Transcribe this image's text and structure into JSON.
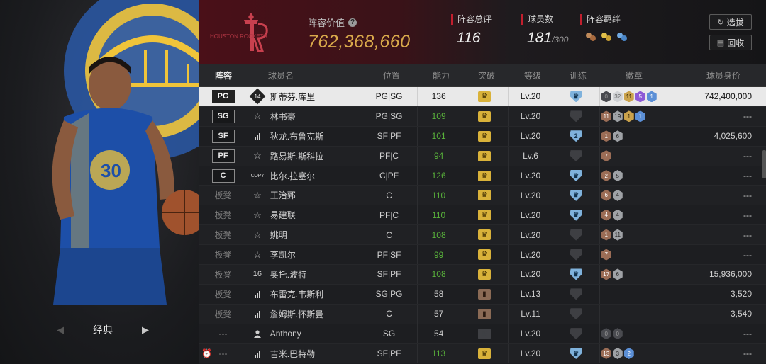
{
  "left_panel": {
    "classic_label": "经典"
  },
  "header": {
    "team_logo_text": "HOUSTON ROCKETS",
    "lineup_value_label": "阵容价值",
    "lineup_value": "762,368,660",
    "overall_label": "阵容总评",
    "overall_value": "116",
    "players_label": "球员数",
    "players_count": "181",
    "players_max": "/300",
    "bond_label": "阵容羁绊",
    "select_button": "选拔",
    "recycle_button": "回收"
  },
  "columns": {
    "lineup": "阵容",
    "name": "球员名",
    "position": "位置",
    "ability": "能力",
    "breakthrough": "突破",
    "level": "等级",
    "training": "训练",
    "badges": "徽章",
    "worth": "球员身价"
  },
  "rows": [
    {
      "slot": "PG",
      "slot_type": "chip",
      "tier": "14",
      "tier_type": "diamond",
      "name": "斯蒂芬.库里",
      "position": "PG|SG",
      "ability": "136",
      "ability_color": "normal",
      "breakthrough": "gold",
      "level": "Lv.20",
      "training": "blue",
      "training_num": "",
      "badges": [
        [
          "empty",
          "0"
        ],
        [
          "lightgray",
          "32"
        ],
        [
          "gold",
          "11"
        ],
        [
          "purple",
          "5"
        ],
        [
          "blue",
          "1"
        ]
      ],
      "worth": "742,400,000",
      "selected": true
    },
    {
      "slot": "SG",
      "slot_type": "chip",
      "tier": "",
      "tier_type": "star",
      "name": "林书豪",
      "position": "PG|SG",
      "ability": "109",
      "ability_color": "green",
      "breakthrough": "gold",
      "level": "Lv.20",
      "training": "gray",
      "training_num": "",
      "badges": [
        [
          "bronze",
          "11"
        ],
        [
          "silver",
          "19"
        ],
        [
          "gold",
          "1"
        ],
        [
          "blue",
          "1"
        ]
      ],
      "worth": "---"
    },
    {
      "slot": "SF",
      "slot_type": "chip",
      "tier": "",
      "tier_type": "bars",
      "name": "狄龙.布鲁克斯",
      "position": "SF|PF",
      "ability": "101",
      "ability_color": "green",
      "breakthrough": "gold",
      "level": "Lv.20",
      "training": "blue",
      "training_num": "2",
      "badges": [
        [
          "bronze",
          "1"
        ],
        [
          "silver",
          "6"
        ]
      ],
      "worth": "4,025,600"
    },
    {
      "slot": "PF",
      "slot_type": "chip",
      "tier": "",
      "tier_type": "star",
      "name": "路易斯.斯科拉",
      "position": "PF|C",
      "ability": "94",
      "ability_color": "green",
      "breakthrough": "gold",
      "level": "Lv.6",
      "training": "gray",
      "training_num": "",
      "badges": [
        [
          "bronze",
          "7"
        ]
      ],
      "worth": "---"
    },
    {
      "slot": "C",
      "slot_type": "chip",
      "tier": "COPY",
      "tier_type": "copy",
      "name": "比尔.拉塞尔",
      "position": "C|PF",
      "ability": "126",
      "ability_color": "green",
      "breakthrough": "gold",
      "level": "Lv.20",
      "training": "blue",
      "training_num": "",
      "badges": [
        [
          "bronze",
          "2"
        ],
        [
          "silver",
          "5"
        ]
      ],
      "worth": "---"
    },
    {
      "slot": "板凳",
      "slot_type": "bench",
      "tier": "",
      "tier_type": "star",
      "name": "王治郅",
      "position": "C",
      "ability": "110",
      "ability_color": "green",
      "breakthrough": "gold",
      "level": "Lv.20",
      "training": "blue",
      "training_num": "",
      "badges": [
        [
          "bronze",
          "6"
        ],
        [
          "silver",
          "4"
        ]
      ],
      "worth": "---"
    },
    {
      "slot": "板凳",
      "slot_type": "bench",
      "tier": "",
      "tier_type": "star",
      "name": "易建联",
      "position": "PF|C",
      "ability": "110",
      "ability_color": "green",
      "breakthrough": "gold",
      "level": "Lv.20",
      "training": "blue",
      "training_num": "",
      "badges": [
        [
          "bronze",
          "4"
        ],
        [
          "silver",
          "4"
        ]
      ],
      "worth": "---"
    },
    {
      "slot": "板凳",
      "slot_type": "bench",
      "tier": "",
      "tier_type": "star",
      "name": "姚明",
      "position": "C",
      "ability": "108",
      "ability_color": "green",
      "breakthrough": "gold",
      "level": "Lv.20",
      "training": "gray",
      "training_num": "",
      "badges": [
        [
          "bronze",
          "1"
        ],
        [
          "silver",
          "11"
        ]
      ],
      "worth": "---"
    },
    {
      "slot": "板凳",
      "slot_type": "bench",
      "tier": "",
      "tier_type": "star",
      "name": "李凯尔",
      "position": "PF|SF",
      "ability": "99",
      "ability_color": "green",
      "breakthrough": "gold",
      "level": "Lv.20",
      "training": "gray",
      "training_num": "",
      "badges": [
        [
          "bronze",
          "7"
        ]
      ],
      "worth": "---"
    },
    {
      "slot": "板凳",
      "slot_type": "bench",
      "tier": "16",
      "tier_type": "num",
      "name": "奥托.波特",
      "position": "SF|PF",
      "ability": "108",
      "ability_color": "green",
      "breakthrough": "gold",
      "level": "Lv.20",
      "training": "blue",
      "training_num": "",
      "badges": [
        [
          "bronze",
          "17"
        ],
        [
          "silver",
          "6"
        ]
      ],
      "worth": "15,936,000"
    },
    {
      "slot": "板凳",
      "slot_type": "bench",
      "tier": "",
      "tier_type": "bars",
      "name": "布雷克.韦斯利",
      "position": "SG|PG",
      "ability": "58",
      "ability_color": "normal",
      "breakthrough": "brown",
      "level": "Lv.13",
      "training": "gray",
      "training_num": "",
      "badges": [],
      "worth": "3,520"
    },
    {
      "slot": "板凳",
      "slot_type": "bench",
      "tier": "",
      "tier_type": "bars",
      "name": "詹姆斯.怀斯曼",
      "position": "C",
      "ability": "57",
      "ability_color": "normal",
      "breakthrough": "brown",
      "level": "Lv.11",
      "training": "gray",
      "training_num": "",
      "badges": [],
      "worth": "3,540"
    },
    {
      "slot": "---",
      "slot_type": "bench",
      "tier": "",
      "tier_type": "person",
      "name": "Anthony",
      "position": "SG",
      "ability": "54",
      "ability_color": "normal",
      "breakthrough": "gray",
      "level": "Lv.20",
      "training": "gray",
      "training_num": "",
      "badges": [
        [
          "empty",
          "0"
        ],
        [
          "empty",
          "0"
        ]
      ],
      "worth": "---"
    },
    {
      "slot": "---",
      "slot_type": "bench",
      "alarm": true,
      "tier": "",
      "tier_type": "bars",
      "name": "吉米.巴特勒",
      "position": "SF|PF",
      "ability": "113",
      "ability_color": "green",
      "breakthrough": "gold",
      "level": "Lv.20",
      "training": "blue",
      "training_num": "",
      "badges": [
        [
          "bronze",
          "13"
        ],
        [
          "silver",
          "3"
        ],
        [
          "blue",
          "2"
        ]
      ],
      "worth": "---"
    }
  ],
  "colors": {
    "accent_gold": "#d9a94b",
    "ability_green": "#59b33b",
    "header_red": "#4a1018",
    "bar_red": "#c21f2e"
  }
}
